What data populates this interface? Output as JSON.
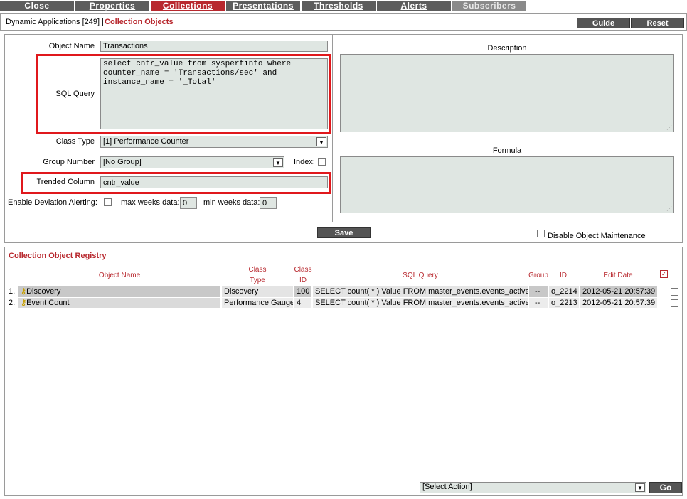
{
  "tabs": [
    {
      "label": "Close",
      "key": ""
    },
    {
      "label": "Properties",
      "key": "P"
    },
    {
      "label": "Collections",
      "key": "C"
    },
    {
      "label": "Presentations",
      "key": "o"
    },
    {
      "label": "Thresholds",
      "key": "T"
    },
    {
      "label": "Alerts",
      "key": "A"
    },
    {
      "label": "Subscribers",
      "key": ""
    }
  ],
  "header": {
    "breadcrumb": "Dynamic Applications [249] |",
    "title": "Collection Objects",
    "guide_label": "Guide",
    "reset_label": "Reset"
  },
  "form": {
    "object_name_label": "Object Name",
    "object_name_value": "Transactions",
    "sql_query_label": "SQL Query",
    "sql_query_value": "select cntr_value from sysperfinfo where\ncounter_name = 'Transactions/sec' and\ninstance_name = '_Total'",
    "class_type_label": "Class Type",
    "class_type_value": "[1] Performance Counter",
    "group_number_label": "Group Number",
    "group_number_value": "[No Group]",
    "index_label": "Index:",
    "trended_column_label": "Trended Column",
    "trended_column_value": "cntr_value",
    "deviation_label": "Enable Deviation Alerting:",
    "max_weeks_label": "max weeks data:",
    "max_weeks_value": "0",
    "min_weeks_label": "min weeks data:",
    "min_weeks_value": "0",
    "description_label": "Description",
    "formula_label": "Formula",
    "save_label": "Save",
    "disable_maintenance_label": "Disable Object Maintenance"
  },
  "registry": {
    "title": "Collection Object Registry",
    "columns": {
      "object_name": "Object Name",
      "class_type": "Class\nType",
      "class_id": "Class\nID",
      "sql_query": "SQL Query",
      "group": "Group",
      "id": "ID",
      "edit_date": "Edit Date"
    },
    "rows": [
      {
        "num": "1.",
        "name": "Discovery",
        "class_type": "Discovery",
        "class_id": "100",
        "sql": "SELECT count( * ) Value FROM master_events.events_active;",
        "group": "--",
        "id": "o_2214",
        "date": "2012-05-21 20:57:39"
      },
      {
        "num": "2.",
        "name": "Event Count",
        "class_type": "Performance Gauge",
        "class_id": "4",
        "sql": "SELECT count( * ) Value FROM master_events.events_active;",
        "group": "--",
        "id": "o_2213",
        "date": "2012-05-21 20:57:39"
      }
    ],
    "select_action_value": "[Select Action]",
    "go_label": "Go"
  },
  "colors": {
    "accent": "#b8282e",
    "highlight": "#e0181c",
    "field_bg": "#dfe6e2",
    "tab_bg": "#5d5d5d"
  }
}
